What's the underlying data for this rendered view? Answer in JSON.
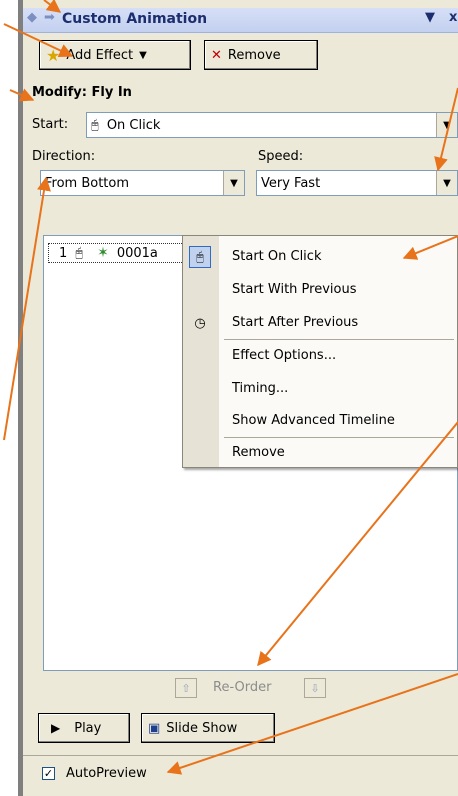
{
  "panel": {
    "title": "Custom Animation",
    "title_controls": [
      "▼",
      "x"
    ]
  },
  "toolbar": {
    "add_effect_label": "Add Effect",
    "remove_label": "Remove"
  },
  "modify": {
    "heading": "Modify: Fly In",
    "start_label": "Start:",
    "start_value": "On Click",
    "direction_label": "Direction:",
    "direction_value": "From Bottom",
    "speed_label": "Speed:",
    "speed_value": "Very Fast"
  },
  "effect_list": {
    "items": [
      {
        "index": "1",
        "name": "0001a"
      }
    ]
  },
  "context_menu": {
    "items": [
      {
        "label": "Start On Click",
        "icon": "mouse-icon",
        "selected": true
      },
      {
        "label": "Start With Previous",
        "icon": ""
      },
      {
        "label": "Start After Previous",
        "icon": "clock-icon"
      },
      {
        "label": "Effect Options...",
        "icon": ""
      },
      {
        "label": "Timing...",
        "icon": ""
      },
      {
        "label": "Show Advanced Timeline",
        "icon": ""
      },
      {
        "label": "Remove",
        "icon": ""
      }
    ]
  },
  "reorder": {
    "label": "Re-Order"
  },
  "footer": {
    "play_label": "Play",
    "slideshow_label": "Slide Show",
    "autopreview_label": "AutoPreview",
    "autopreview_checked": true
  },
  "colors": {
    "panel_bg": "#ece9d8",
    "title_text": "#1c2e6e",
    "annotation_arrow": "#e8731a",
    "menu_highlight": "#316ac5"
  }
}
